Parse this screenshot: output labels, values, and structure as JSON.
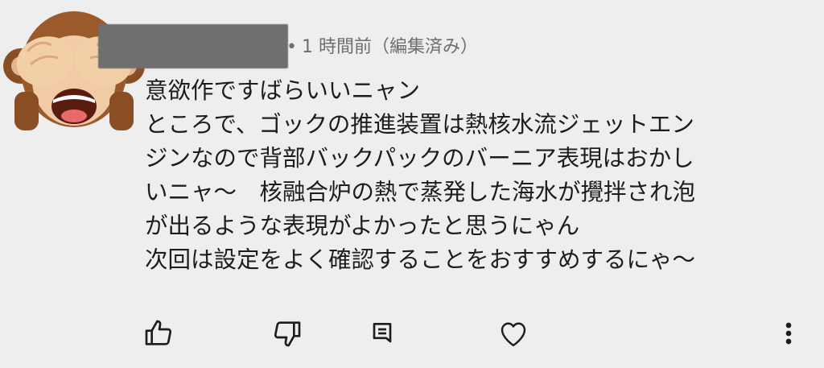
{
  "comment": {
    "author_redacted": true,
    "separator": "•",
    "timestamp": "1 時間前（編集済み）",
    "lines": [
      "意欲作ですばらいいニャン",
      "ところで、ゴックの推進装置は熱核水流ジェットエン",
      "ジンなので背部バックパックのバーニア表現はおかし",
      "いニャ〜　核融合炉の熱で蒸発した海水が攪拌され泡",
      "が出るような表現がよかったと思うにゃん",
      "次回は設定をよく確認することをおすすめするにゃ〜"
    ]
  },
  "actions": {
    "like_icon": "thumbs-up-icon",
    "dislike_icon": "thumbs-down-icon",
    "reply_icon": "reply-comment-icon",
    "heart_icon": "heart-icon",
    "more_icon": "more-vertical-icon"
  },
  "colors": {
    "background": "#eeeeee",
    "text": "#1d1d1d",
    "meta_text": "#6e6e6e"
  }
}
